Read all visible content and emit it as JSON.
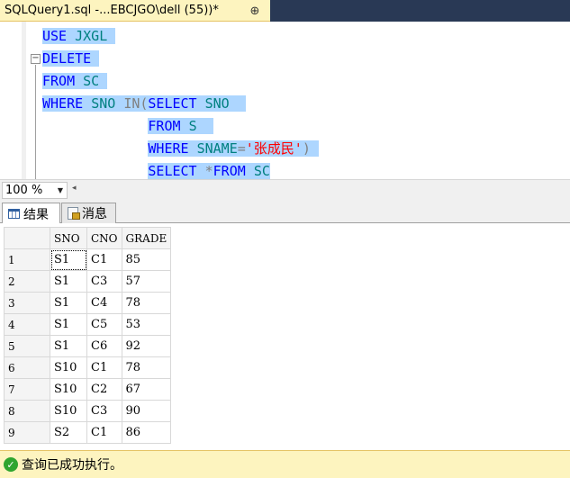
{
  "tab": {
    "title": "SQLQuery1.sql -...EBCJGO\\dell (55))*",
    "pin_glyph": "⊕"
  },
  "editor": {
    "collapse_glyph": "−",
    "lines": [
      {
        "tokens": [
          {
            "t": "USE",
            "c": "kw"
          },
          {
            "t": " "
          },
          {
            "t": "JXGL",
            "c": "id"
          },
          {
            "t": " "
          }
        ]
      },
      {
        "tokens": [
          {
            "t": "DELETE",
            "c": "kw"
          },
          {
            "t": " "
          }
        ]
      },
      {
        "tokens": [
          {
            "t": "FROM",
            "c": "kw"
          },
          {
            "t": " "
          },
          {
            "t": "SC",
            "c": "id"
          },
          {
            "t": " "
          }
        ]
      },
      {
        "tokens": [
          {
            "t": "WHERE",
            "c": "kw"
          },
          {
            "t": " "
          },
          {
            "t": "SNO",
            "c": "id"
          },
          {
            "t": " "
          },
          {
            "t": "IN",
            "c": "op"
          },
          {
            "t": "(",
            "c": "op"
          },
          {
            "t": "SELECT",
            "c": "kw"
          },
          {
            "t": " "
          },
          {
            "t": "SNO",
            "c": "id"
          },
          {
            "t": "  "
          }
        ]
      },
      {
        "indent": "             ",
        "tokens": [
          {
            "t": "FROM",
            "c": "kw"
          },
          {
            "t": " "
          },
          {
            "t": "S",
            "c": "id"
          },
          {
            "t": "  "
          }
        ]
      },
      {
        "indent": "             ",
        "tokens": [
          {
            "t": "WHERE",
            "c": "kw"
          },
          {
            "t": " "
          },
          {
            "t": "SNAME",
            "c": "id"
          },
          {
            "t": "=",
            "c": "op"
          },
          {
            "t": "'张成民'",
            "c": "str"
          },
          {
            "t": ")",
            "c": "op"
          },
          {
            "t": " "
          }
        ]
      },
      {
        "indent": "             ",
        "tokens": [
          {
            "t": "SELECT",
            "c": "kw"
          },
          {
            "t": " "
          },
          {
            "t": "*",
            "c": "op"
          },
          {
            "t": "FROM",
            "c": "kw"
          },
          {
            "t": " "
          },
          {
            "t": "SC",
            "c": "id"
          }
        ]
      }
    ]
  },
  "zoom": {
    "value": "100 %",
    "arrow": "▼",
    "scroll_left": "◂"
  },
  "result_tabs": {
    "results": "结果",
    "messages": "消息"
  },
  "grid": {
    "columns": [
      "SNO",
      "CNO",
      "GRADE"
    ],
    "rows": [
      {
        "n": "1",
        "cells": [
          "S1",
          "C1",
          "85"
        ]
      },
      {
        "n": "2",
        "cells": [
          "S1",
          "C3",
          "57"
        ]
      },
      {
        "n": "3",
        "cells": [
          "S1",
          "C4",
          "78"
        ]
      },
      {
        "n": "4",
        "cells": [
          "S1",
          "C5",
          "53"
        ]
      },
      {
        "n": "5",
        "cells": [
          "S1",
          "C6",
          "92"
        ]
      },
      {
        "n": "6",
        "cells": [
          "S10",
          "C1",
          "78"
        ]
      },
      {
        "n": "7",
        "cells": [
          "S10",
          "C2",
          "67"
        ]
      },
      {
        "n": "8",
        "cells": [
          "S10",
          "C3",
          "90"
        ]
      },
      {
        "n": "9",
        "cells": [
          "S2",
          "C1",
          "86"
        ]
      }
    ]
  },
  "status": {
    "text": "查询已成功执行。",
    "icon": "✓"
  }
}
